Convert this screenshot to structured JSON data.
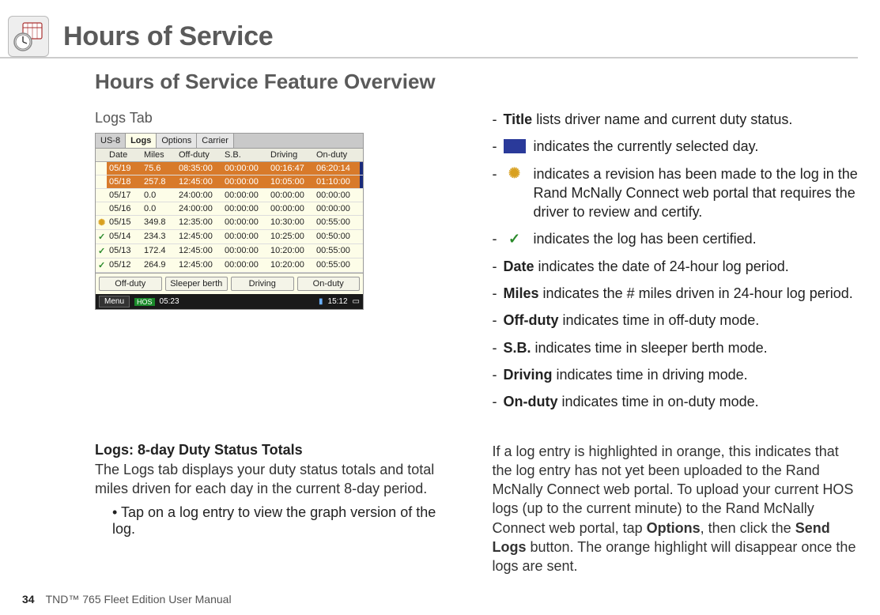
{
  "header": {
    "title": "Hours of Service"
  },
  "subtitle": "Hours of Service Feature Overview",
  "left": {
    "tab_label": "Logs Tab",
    "section_title": "Logs: 8-day Duty Status Totals",
    "section_body": "The Logs tab displays your duty status totals and total miles driven for each day in the current 8-day period.",
    "bullet": "Tap on a log entry to view the graph version of the log."
  },
  "screenshot": {
    "tabs": [
      "US-8",
      "Logs",
      "Options",
      "Carrier"
    ],
    "headers": [
      "Date",
      "Miles",
      "Off-duty",
      "S.B.",
      "Driving",
      "On-duty"
    ],
    "rows": [
      {
        "icon": "",
        "hl": true,
        "cells": [
          "05/19",
          "75.6",
          "08:35:00",
          "00:00:00",
          "00:16:47",
          "06:20:14"
        ]
      },
      {
        "icon": "",
        "hl": true,
        "cells": [
          "05/18",
          "257.8",
          "12:45:00",
          "00:00:00",
          "10:05:00",
          "01:10:00"
        ]
      },
      {
        "icon": "",
        "hl": false,
        "cells": [
          "05/17",
          "0.0",
          "24:00:00",
          "00:00:00",
          "00:00:00",
          "00:00:00"
        ]
      },
      {
        "icon": "",
        "hl": false,
        "cells": [
          "05/16",
          "0.0",
          "24:00:00",
          "00:00:00",
          "00:00:00",
          "00:00:00"
        ]
      },
      {
        "icon": "star",
        "hl": false,
        "cells": [
          "05/15",
          "349.8",
          "12:35:00",
          "00:00:00",
          "10:30:00",
          "00:55:00"
        ]
      },
      {
        "icon": "check",
        "hl": false,
        "cells": [
          "05/14",
          "234.3",
          "12:45:00",
          "00:00:00",
          "10:25:00",
          "00:50:00"
        ]
      },
      {
        "icon": "check",
        "hl": false,
        "cells": [
          "05/13",
          "172.4",
          "12:45:00",
          "00:00:00",
          "10:20:00",
          "00:55:00"
        ]
      },
      {
        "icon": "check",
        "hl": false,
        "cells": [
          "05/12",
          "264.9",
          "12:45:00",
          "00:00:00",
          "10:20:00",
          "00:55:00"
        ]
      }
    ],
    "duty_buttons": [
      "Off-duty",
      "Sleeper berth",
      "Driving",
      "On-duty"
    ],
    "status": {
      "menu": "Menu",
      "hos": "HOS",
      "time_left": "05:23",
      "time_right": "15:12"
    }
  },
  "defs": [
    {
      "type": "bold",
      "term": "Title",
      "text": " lists driver name and current duty status."
    },
    {
      "type": "icon-blue",
      "text": "indicates the currently selected day."
    },
    {
      "type": "icon-star",
      "text": "indicates a revision has been made to the log in the Rand McNally Connect web portal that requires the driver to review and certify."
    },
    {
      "type": "icon-check",
      "text": "indicates the log has been certified."
    },
    {
      "type": "bold",
      "term": "Date",
      "text": " indicates the date of 24-hour log period."
    },
    {
      "type": "bold",
      "term": "Miles",
      "text": " indicates the # miles driven in 24-hour log period."
    },
    {
      "type": "bold",
      "term": "Off-duty",
      "text": " indicates time in off-duty mode."
    },
    {
      "type": "bold",
      "term": "S.B.",
      "text": " indicates time in sleeper berth mode."
    },
    {
      "type": "bold",
      "term": "Driving",
      "text": " indicates time in driving mode."
    },
    {
      "type": "bold",
      "term": "On-duty",
      "text": " indicates time in on-duty mode."
    }
  ],
  "lower_right": {
    "p1": "If a log entry is highlighted in orange, this indicates that the log entry has not yet been uploaded to the Rand McNally Connect web portal. To upload your current HOS logs (up to the current minute) to the Rand McNally Connect web portal, tap ",
    "b1": "Options",
    "p2": ", then click the ",
    "b2": "Send Logs",
    "p3": " button. The orange highlight will disappear once the logs are sent."
  },
  "footer": {
    "page": "34",
    "doc": "TND™ 765 Fleet Edition User Manual"
  }
}
